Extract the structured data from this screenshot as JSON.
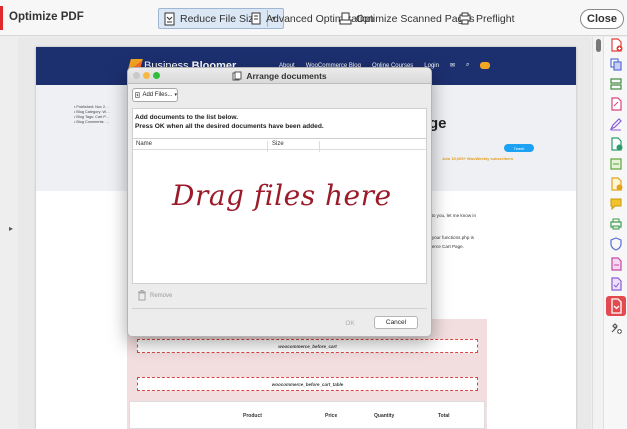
{
  "toolbar": {
    "title": "Optimize PDF",
    "reduce_label": "Reduce File Size",
    "advanced_label": "Advanced Optimization",
    "scanned_label": "Optimize Scanned Pages",
    "preflight_label": "Preflight",
    "close_label": "Close"
  },
  "page": {
    "brand_light": "Business ",
    "brand_bold": "Bloomer",
    "nav": [
      "About",
      "WooCommerce Blog",
      "Online Courses",
      "Login"
    ],
    "hero_lines": [
      "• Published: Nov 2…",
      "• Blog Category: W…",
      "• Blog Tags: Cart P…",
      "• Blog Comments: …"
    ],
    "hero_title_fragment": "ge",
    "tweet_label": "Tweet",
    "join_text": "Join 15,000+ WooWeekly subscribers",
    "body_right": [
      "it to you, let me know in",
      "n your functions.php is",
      "merce Cart Page."
    ],
    "hook_before_cart": "woocommerce_before_cart",
    "hook_before_cart_table": "woocommerce_before_cart_table",
    "table_headers": [
      "Product",
      "Price",
      "Quantity",
      "Total"
    ]
  },
  "dialog": {
    "title": "Arrange documents",
    "add_files_label": "Add Files...",
    "instruction_line1": "Add documents to the list below.",
    "instruction_line2": "Press OK when all the desired documents have been added.",
    "col_name": "Name",
    "col_size": "Size",
    "drag_hint": "Drag files here",
    "remove_label": "Remove",
    "ok_label": "OK",
    "cancel_label": "Cancel"
  },
  "colors": {
    "accent_red": "#e0292c",
    "drag_hint": "#9c1b2a",
    "site_header": "#1c2f6f",
    "active_tool": "#e24a4f"
  },
  "right_tools": [
    "create-pdf-icon",
    "combine-files-icon",
    "organize-pages-icon",
    "edit-pdf-icon",
    "fill-sign-icon",
    "export-pdf-icon",
    "scan-ocr-icon",
    "send-for-review-icon",
    "comment-icon",
    "print-production-icon",
    "protect-icon",
    "accessibility-icon",
    "standards-icon",
    "optimize-pdf-icon",
    "more-tools-icon"
  ]
}
